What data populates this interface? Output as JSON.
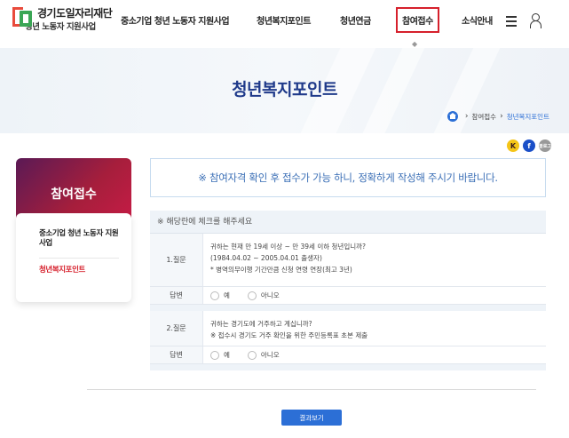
{
  "header": {
    "logo_title": "경기도일자리재단",
    "logo_sub": "청년 노동자 지원사업",
    "nav": [
      {
        "label": "중소기업 청년 노동자 지원사업"
      },
      {
        "label": "청년복지포인트"
      },
      {
        "label": "청년연금"
      },
      {
        "label": "참여접수",
        "active": true
      },
      {
        "label": "소식안내"
      }
    ],
    "hover_marker": "◆"
  },
  "banner": {
    "title": "청년복지포인트",
    "breadcrumb": [
      "참여접수",
      "청년복지포인트"
    ]
  },
  "share": {
    "kakao": "K",
    "facebook": "f",
    "blog": "블로그"
  },
  "sidebar": {
    "title": "참여접수",
    "items": [
      {
        "label": "중소기업 청년 노동자 지원사업"
      },
      {
        "label": "청년복지포인트",
        "active": true
      }
    ]
  },
  "notice": "※ 참여자격 확인 후 접수가 가능 하니, 정확하게 작성해 주시기 바랍니다.",
  "form": {
    "header": "※ 해당란에 체크를 해주세요",
    "questions": [
      {
        "label": "1.질문",
        "lines": [
          "귀하는 현재 만 19세 이상 ~ 만 39세 이하 청년입니까?",
          "(1984.04.02 ~ 2005.04.01 출생자)",
          "* 병역의무이행 기간만큼 신청 연령 연장(최고 3년)"
        ]
      },
      {
        "label": "2.질문",
        "lines": [
          "귀하는 경기도에 거주하고 계십니까?",
          "※ 접수시 경기도 거주 확인을 위한 주민등록표 초본 제출"
        ]
      }
    ],
    "answer_label": "답변",
    "options": [
      "예",
      "아니오"
    ]
  },
  "submit_label": "결과보기",
  "colors": {
    "accent": "#2c6fd6",
    "active_red": "#d6202c",
    "title_blue": "#1f3a8a",
    "sidebar_gradient_start": "#5a1a55",
    "sidebar_gradient_end": "#c41c45"
  }
}
